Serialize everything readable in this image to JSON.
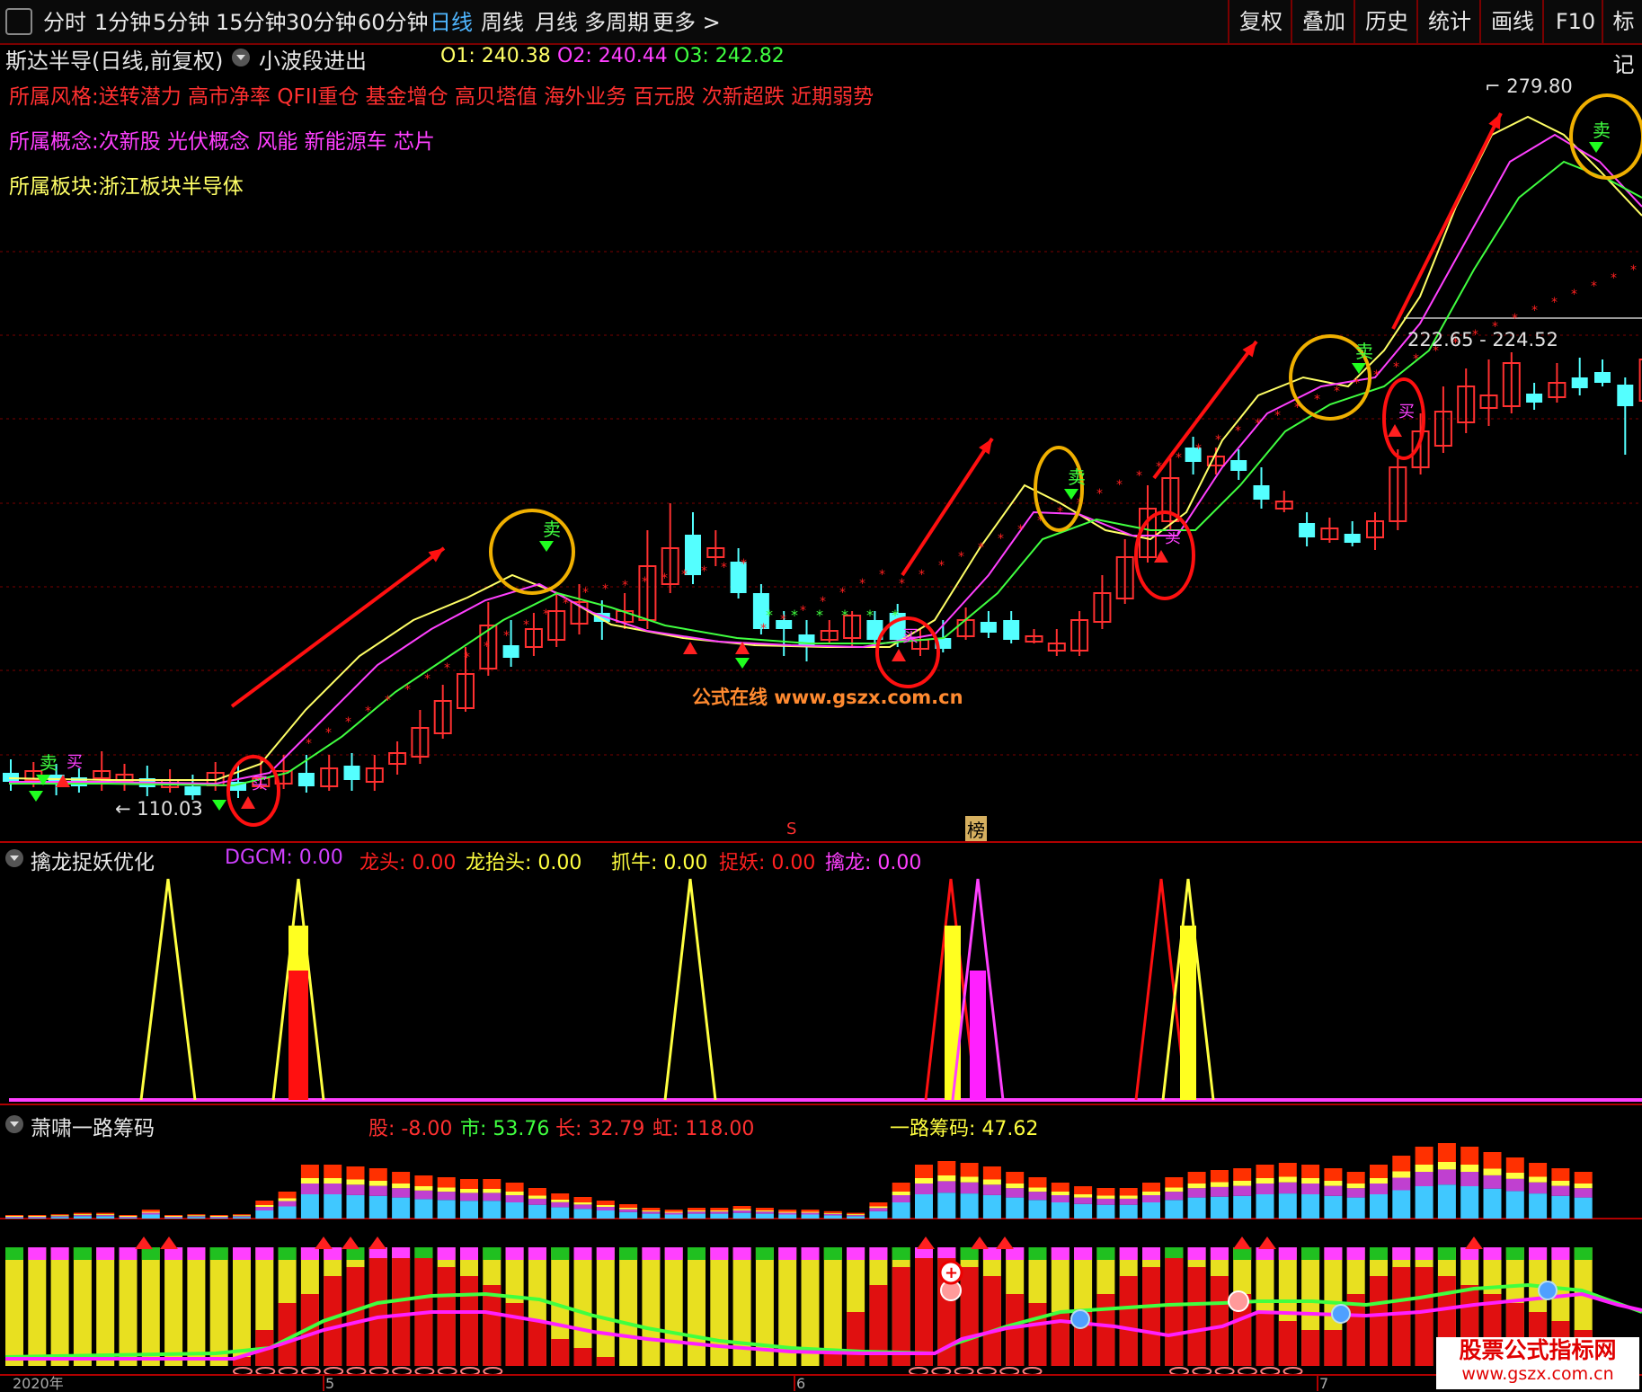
{
  "toolbar": {
    "periods": [
      "分时",
      "1分钟",
      "5分钟",
      "15分钟",
      "30分钟",
      "60分钟",
      "日线",
      "周线",
      "月线",
      "多周期",
      "更多 >"
    ],
    "active": "日线",
    "right_buttons": [
      "复权",
      "叠加",
      "历史",
      "统计",
      "画线",
      "F10",
      "标记"
    ]
  },
  "main_chart": {
    "stock_title": "斯达半导(日线,前复权)",
    "indicator_name": "小波段进出",
    "o1_label": "O1:",
    "o1_value": "240.38",
    "o2_label": "O2:",
    "o2_value": "240.44",
    "o3_label": "O3:",
    "o3_value": "242.82",
    "style_line": "所属风格:送转潜力 高市净率 QFII重仓 基金增仓 高贝塔值 海外业务 百元股 次新超跌 近期弱势",
    "concept_line": "所属概念:次新股 光伏概念 风能 新能源车 芯片",
    "sector_line": "所属板块:浙江板块半导体",
    "high_label": "279.80",
    "low_label": "110.03",
    "range_label": "222.65 - 224.52",
    "watermark": "公式在线  www.gszx.com.cn",
    "marker_s": "S",
    "marker_bang": "榜",
    "buy_glyph": "买",
    "sell_glyph": "卖"
  },
  "panel2": {
    "title": "擒龙捉妖优化",
    "values": [
      {
        "label": "DGCM:",
        "value": "0.00",
        "color": "#d040ff"
      },
      {
        "label": "龙头:",
        "value": "0.00",
        "color": "#ff2020"
      },
      {
        "label": "龙抬头:",
        "value": "0.00",
        "color": "#ffff40"
      },
      {
        "label": "抓牛:",
        "value": "0.00",
        "color": "#ffff40"
      },
      {
        "label": "捉妖:",
        "value": "0.00",
        "color": "#ff2020"
      },
      {
        "label": "擒龙:",
        "value": "0.00",
        "color": "#ff40ff"
      }
    ]
  },
  "panel3": {
    "title": "萧啸一路筹码",
    "values": [
      {
        "label": "股:",
        "value": "-8.00",
        "color": "#ff3030"
      },
      {
        "label": "市:",
        "value": "53.76",
        "color": "#40ff40"
      },
      {
        "label": "长:",
        "value": "32.79",
        "color": "#ff3030"
      },
      {
        "label": "虹:",
        "value": "118.00",
        "color": "#ff3030"
      },
      {
        "label": "一路筹码:",
        "value": "47.62",
        "color": "#ffff40"
      }
    ]
  },
  "bottom_axis": {
    "labels": [
      "2020年",
      "5",
      "6",
      "7"
    ]
  },
  "corner_watermark": {
    "line1": "股票公式指标网",
    "line2": "www.gszx.com.cn"
  },
  "colors": {
    "up": "#ff3030",
    "down": "#54ffff",
    "ma1": "#ffff66",
    "ma2": "#ff40ff",
    "ma3": "#40ff40",
    "sar": "#ff2020",
    "sell_circle": "#f0b000",
    "buy_circle": "#ff1010"
  }
}
